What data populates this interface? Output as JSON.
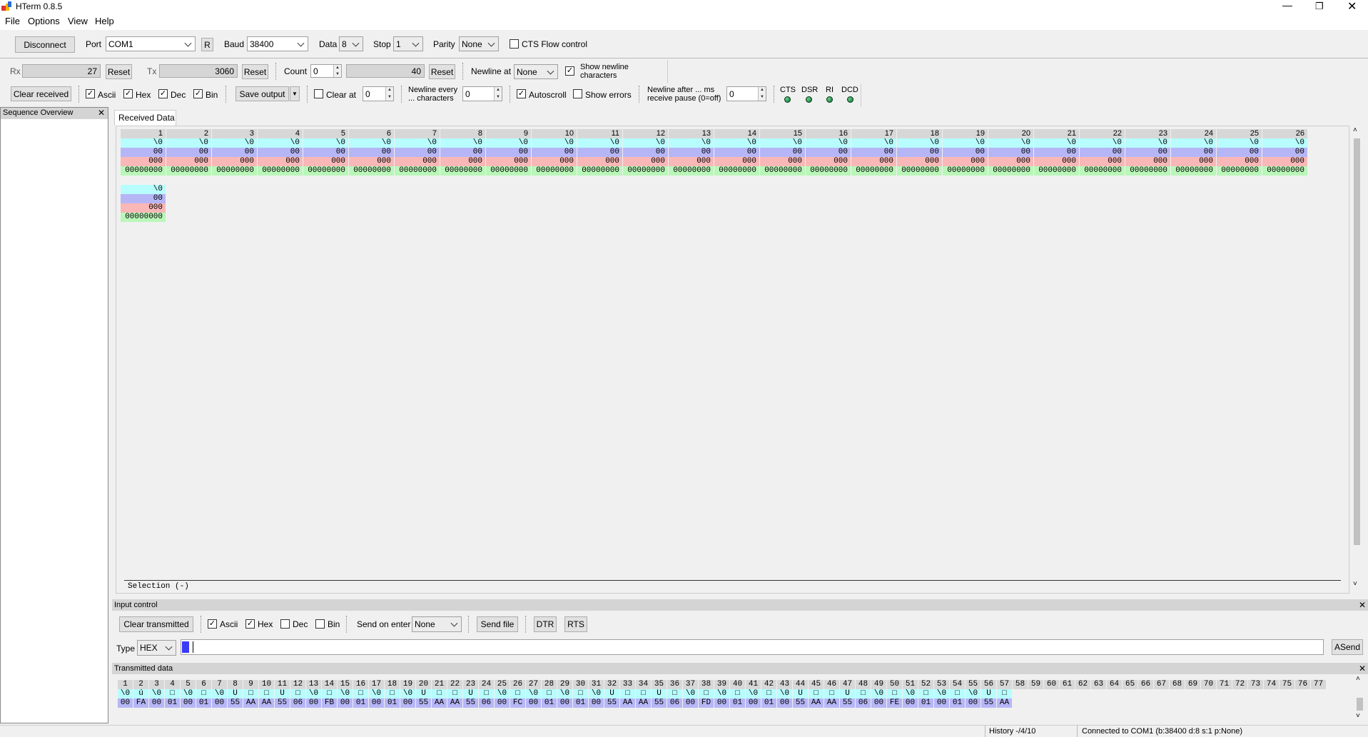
{
  "window": {
    "title": "HTerm 0.8.5"
  },
  "menu": [
    "File",
    "Options",
    "View",
    "Help"
  ],
  "toolbar1": {
    "disconnect": "Disconnect",
    "port_label": "Port",
    "port_value": "COM1",
    "r_label": "R",
    "baud_label": "Baud",
    "baud_value": "38400",
    "data_label": "Data",
    "data_value": "8",
    "stop_label": "Stop",
    "stop_value": "1",
    "parity_label": "Parity",
    "parity_value": "None",
    "cts_label": "CTS Flow control"
  },
  "toolbar2": {
    "rx_label": "Rx",
    "rx_value": "27",
    "rx_reset": "Reset",
    "tx_label": "Tx",
    "tx_value": "3060",
    "tx_reset": "Reset",
    "count_label": "Count",
    "count_value": "0",
    "count_total": "40",
    "count_reset": "Reset",
    "newline_label": "Newline at",
    "newline_value": "None",
    "show_newline_line1": "Show newline",
    "show_newline_line2": "characters"
  },
  "toolbar3": {
    "clear_received": "Clear received",
    "ascii": "Ascii",
    "hex": "Hex",
    "dec": "Dec",
    "bin": "Bin",
    "save_output": "Save output",
    "clear_at": "Clear at",
    "clear_at_value": "0",
    "newline_every_line1": "Newline every",
    "newline_every_line2": "... characters",
    "newline_every_value": "0",
    "autoscroll": "Autoscroll",
    "show_errors": "Show errors",
    "newline_after_line1": "Newline after ... ms",
    "newline_after_line2": "receive pause (0=off)",
    "newline_after_value": "0",
    "signals": [
      "CTS",
      "DSR",
      "RI",
      "DCD"
    ]
  },
  "sidebar": {
    "title": "Sequence Overview"
  },
  "received": {
    "tab": "Received Data",
    "selection": "Selection (-)",
    "columns": [
      "1",
      "2",
      "3",
      "4",
      "5",
      "6",
      "7",
      "8",
      "9",
      "10",
      "11",
      "12",
      "13",
      "14",
      "15",
      "16",
      "17",
      "18",
      "19",
      "20",
      "21",
      "22",
      "23",
      "24",
      "25",
      "26"
    ],
    "ascii": "\\0",
    "hex": "00",
    "dec": "000",
    "bin": "00000000"
  },
  "input_control": {
    "title": "Input control",
    "clear_transmitted": "Clear transmitted",
    "ascii": "Ascii",
    "hex": "Hex",
    "dec": "Dec",
    "bin": "Bin",
    "send_on_enter_label": "Send on enter",
    "send_on_enter_value": "None",
    "send_file": "Send file",
    "dtr": "DTR",
    "rts": "RTS",
    "type_label": "Type",
    "type_value": "HEX",
    "asend": "ASend"
  },
  "transmitted": {
    "title": "Transmitted data",
    "hex": [
      "00",
      "FA",
      "00",
      "01",
      "00",
      "01",
      "00",
      "55",
      "AA",
      "AA",
      "55",
      "06",
      "00",
      "FB",
      "00",
      "01",
      "00",
      "01",
      "00",
      "55",
      "AA",
      "AA",
      "55",
      "06",
      "00",
      "FC",
      "00",
      "01",
      "00",
      "01",
      "00",
      "55",
      "AA",
      "AA",
      "55",
      "06",
      "00",
      "FD",
      "00",
      "01",
      "00",
      "01",
      "00",
      "55",
      "AA",
      "AA",
      "55",
      "06",
      "00",
      "FE",
      "00",
      "01",
      "00",
      "01",
      "00",
      "55",
      "AA"
    ],
    "ascii": [
      "\\0",
      "ú",
      "\\0",
      "□",
      "\\0",
      "□",
      "\\0",
      "U",
      "□",
      "□",
      "U",
      "□",
      "\\0",
      "□",
      "\\0",
      "□",
      "\\0",
      "□",
      "\\0",
      "U",
      "□",
      "□",
      "U",
      "□",
      "\\0",
      "□",
      "\\0",
      "□",
      "\\0",
      "□",
      "\\0",
      "U",
      "□",
      "□",
      "U",
      "□",
      "\\0",
      "□",
      "\\0",
      "□",
      "\\0",
      "□",
      "\\0",
      "U",
      "□",
      "□",
      "U",
      "□",
      "\\0",
      "□",
      "\\0",
      "□",
      "\\0",
      "□",
      "\\0",
      "U",
      "□"
    ],
    "count": 77
  },
  "status": {
    "history": "History -/4/10",
    "connection": "Connected to COM1 (b:38400 d:8 s:1 p:None)"
  },
  "colors": {
    "ascii_row": "#b8fdfd",
    "hex_row": "#b6b6f7",
    "dec_row": "#f9b7b7",
    "bin_row": "#b9f7b9",
    "header_row": "#d7d7d7"
  }
}
